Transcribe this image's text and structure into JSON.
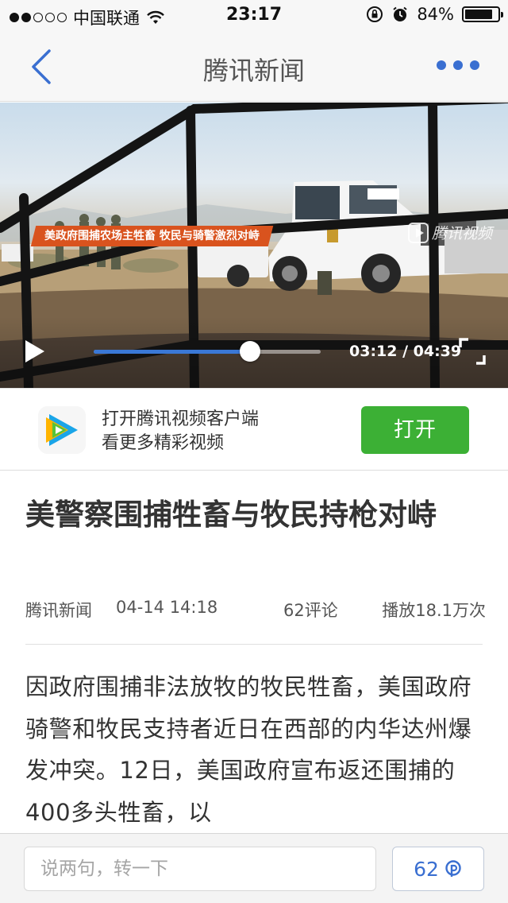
{
  "status_bar": {
    "carrier": "中国联通",
    "time": "23:17",
    "battery": "84%",
    "battery_level": 0.84,
    "signal_strength": 2,
    "signal_total": 5
  },
  "nav": {
    "title": "腾讯新闻"
  },
  "video": {
    "banner": "美政府围捕农场主牲畜 牧民与骑警激烈对峙",
    "watermark": "腾讯视频",
    "current_time": "03:12",
    "duration": "04:39",
    "time_display": "03:12 / 04:39",
    "progress_fraction": 0.688
  },
  "promo": {
    "line1": "打开腾讯视频客户端",
    "line2": "看更多精彩视频",
    "button_label": "打开",
    "accent_color": "#3cb035"
  },
  "article": {
    "title": "美警察围捕牲畜与牧民持枪对峙",
    "source": "腾讯新闻",
    "date": "04-14 14:18",
    "comments": "62评论",
    "plays": "播放18.1万次",
    "body": "因政府围捕非法放牧的牧民牲畜，美国政府骑警和牧民支持者近日在西部的内华达州爆发冲突。12日，美国政府宣布返还围捕的400多头牲畜，以"
  },
  "bottom_bar": {
    "input_placeholder": "说两句，转一下",
    "comment_count": "62"
  },
  "colors": {
    "brand_blue": "#3a6fd1",
    "video_progress": "#3a78d6",
    "banner_orange": "#d9531e"
  }
}
